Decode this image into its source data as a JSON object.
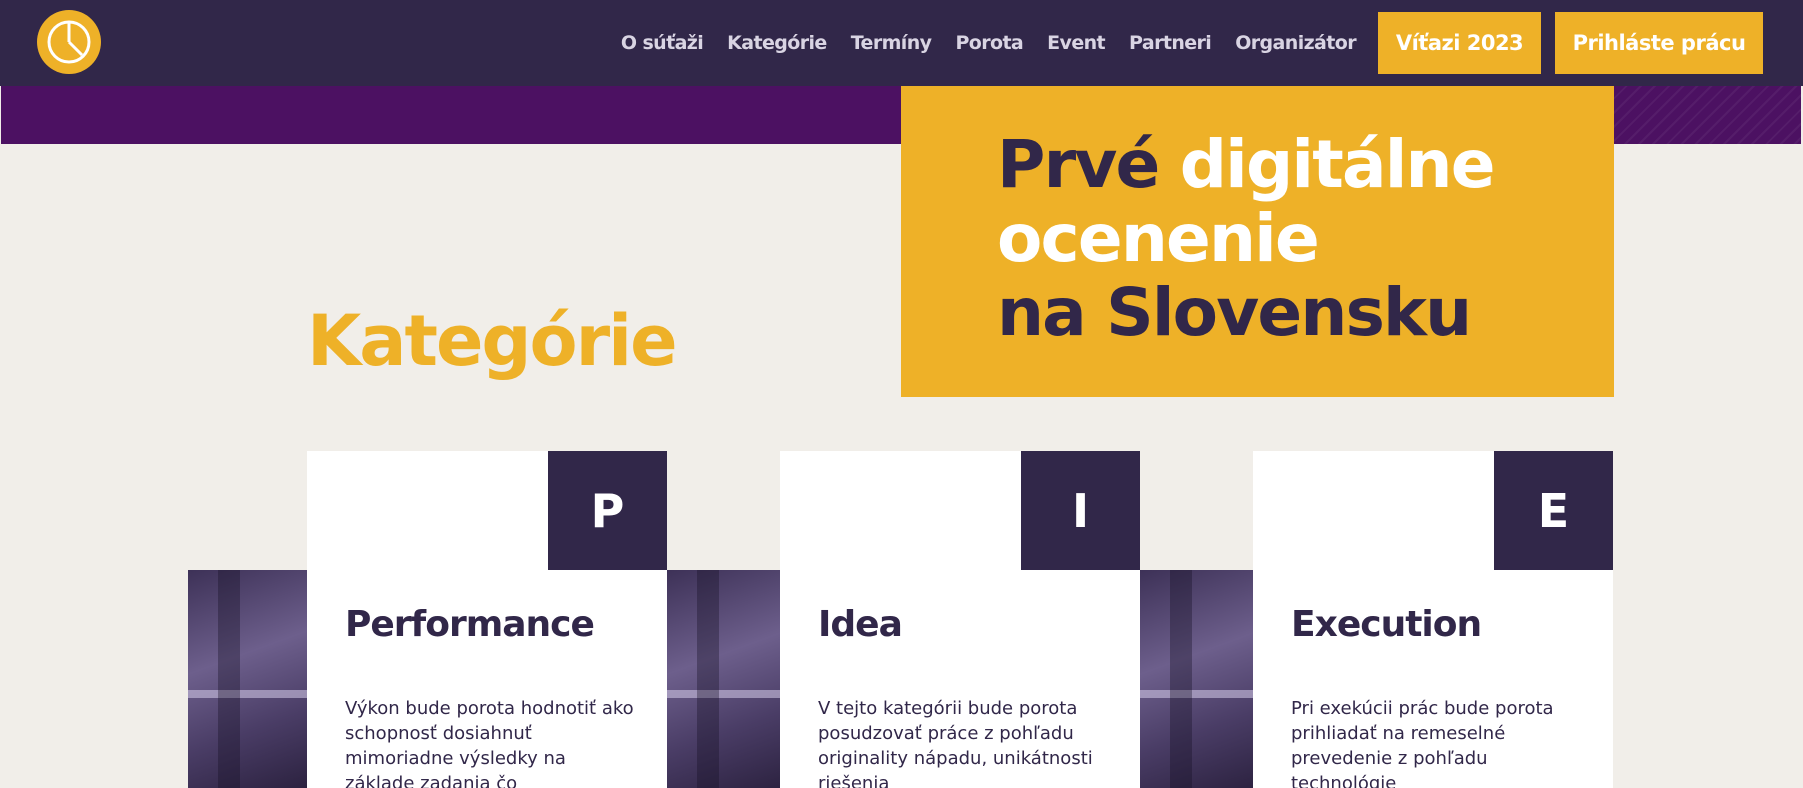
{
  "colors": {
    "navy": "#312749",
    "yellow": "#eeb128",
    "purple": "#4c1162",
    "background": "#f1eee9",
    "white": "#ffffff"
  },
  "header": {
    "logo_icon": "clock-icon",
    "nav": [
      "O súťaži",
      "Kategórie",
      "Termíny",
      "Porota",
      "Event",
      "Partneri",
      "Organizátor"
    ],
    "winners_button": "Víťazi 2023",
    "submit_button": "Prihláste prácu"
  },
  "hero": {
    "line1_dark": "Prvé",
    "line1_light": "digitálne",
    "line2_light": "ocenenie",
    "line3_dark": "na Slovensku"
  },
  "categories": {
    "title": "Kategórie",
    "cards": [
      {
        "letter": "P",
        "title": "Performance",
        "text": "Výkon bude porota hodnotiť ako schopnosť dosiahnuť mimoriadne výsledky na základe zadania čo"
      },
      {
        "letter": "I",
        "title": "Idea",
        "text": "V tejto kategórii bude porota posudzovať práce z pohľadu originality nápadu, unikátnosti riešenia"
      },
      {
        "letter": "E",
        "title": "Execution",
        "text": "Pri exekúcii prác bude porota prihliadať na remeselné prevedenie z pohľadu technológie"
      }
    ]
  }
}
